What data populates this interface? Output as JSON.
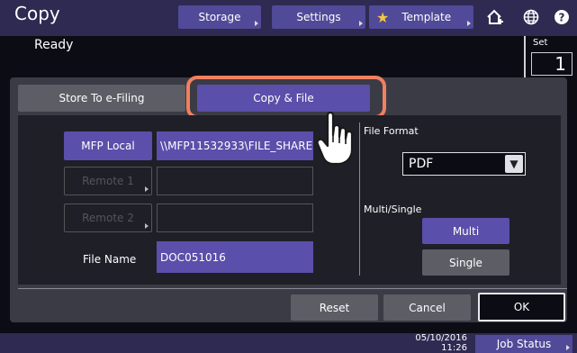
{
  "header": {
    "title": "Copy",
    "status": "Ready",
    "buttons": {
      "storage": "Storage",
      "settings": "Settings",
      "template": "Template"
    },
    "icons": [
      "star-icon",
      "home-plus-icon",
      "globe-icon",
      "help-icon"
    ]
  },
  "set": {
    "label": "Set",
    "value": "1"
  },
  "tabs": {
    "store_to_efiling": "Store To e-Filing",
    "copy_and_file": "Copy & File"
  },
  "destinations": {
    "mfp_local": {
      "label": "MFP Local",
      "path": "\\\\MFP11532933\\FILE_SHARE"
    },
    "remote1": {
      "label": "Remote 1",
      "path": ""
    },
    "remote2": {
      "label": "Remote 2",
      "path": ""
    }
  },
  "file_name": {
    "label": "File Name",
    "value": "DOC051016"
  },
  "file_format": {
    "label": "File Format",
    "selected": "PDF"
  },
  "multi_single": {
    "label": "Multi/Single",
    "multi": "Multi",
    "single": "Single",
    "selected": "Multi"
  },
  "actions": {
    "reset": "Reset",
    "cancel": "Cancel",
    "ok": "OK"
  },
  "footer": {
    "date": "05/10/2016",
    "time": "11:26",
    "job_status": "Job Status"
  },
  "colors": {
    "accent": "#5a4faa",
    "highlight": "#f08060",
    "header_bg": "#2e2a52"
  }
}
